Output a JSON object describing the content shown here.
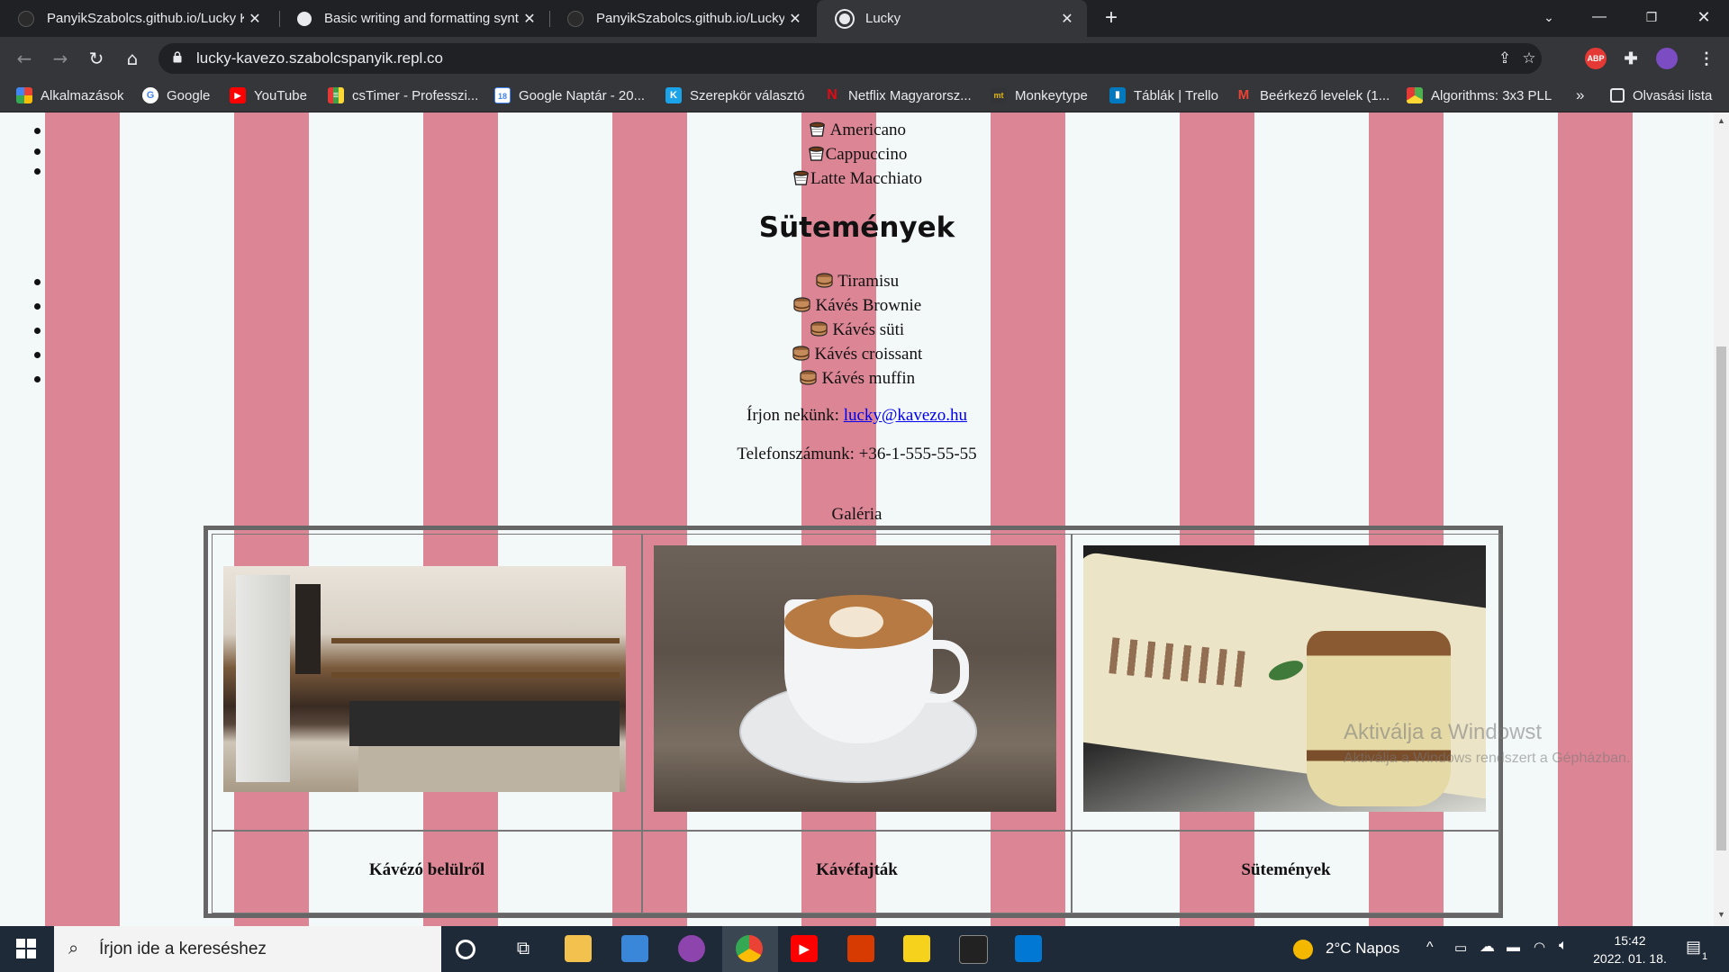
{
  "browser": {
    "tabs": [
      {
        "title": "PanyikSzabolcs.github.io/Lucky K",
        "active": false
      },
      {
        "title": "Basic writing and formatting synt",
        "active": false
      },
      {
        "title": "PanyikSzabolcs.github.io/Lucky K",
        "active": false
      },
      {
        "title": "Lucky",
        "active": true
      }
    ],
    "new_tab": "+",
    "url": "lucky-kavezo.szabolcspanyik.repl.co",
    "ext_abp": "ABP",
    "bookmarks": [
      {
        "label": "Alkalmazások",
        "icon": "apps-grid-icon",
        "color": "#4285f4",
        "glyph": ""
      },
      {
        "label": "Google",
        "icon": "google-icon",
        "color": "#ffffff",
        "glyph": "G"
      },
      {
        "label": "YouTube",
        "icon": "youtube-icon",
        "color": "#ff0000",
        "glyph": "▶"
      },
      {
        "label": "csTimer - Professzi...",
        "icon": "cstimer-icon",
        "color": "#e53935",
        "glyph": "≡"
      },
      {
        "label": "Google Naptár - 20...",
        "icon": "calendar-icon",
        "color": "#4285f4",
        "glyph": "18"
      },
      {
        "label": "Szerepkör választó",
        "icon": "kreta-icon",
        "color": "#1aa3e8",
        "glyph": "K"
      },
      {
        "label": "Netflix Magyarorsz...",
        "icon": "netflix-icon",
        "color": "#202124",
        "glyph": "N"
      },
      {
        "label": "Monkeytype",
        "icon": "monkeytype-icon",
        "color": "#323437",
        "glyph": "mt"
      },
      {
        "label": "Táblák | Trello",
        "icon": "trello-icon",
        "color": "#0079bf",
        "glyph": "▮"
      },
      {
        "label": "Beérkező levelek (1...",
        "icon": "gmail-icon",
        "color": "#202124",
        "glyph": "M"
      },
      {
        "label": "Algorithms: 3x3 PLL",
        "icon": "cube-icon",
        "color": "#4caf50",
        "glyph": "◆"
      }
    ],
    "more": "»",
    "reading_list": "Olvasási lista"
  },
  "page": {
    "coffee_items": [
      "Americano",
      "Cappuccino",
      "Latte Macchiato"
    ],
    "desserts_heading": "Sütemények",
    "dessert_items": [
      "Tiramisu",
      "Kávés Brownie",
      "Kávés süti",
      "Kávés croissant",
      "Kávés muffin"
    ],
    "email_label": "Írjon nekünk: ",
    "email": "lucky@kavezo.hu",
    "phone_label": "Telefonszámunk: +36-1-555-55-55",
    "gallery_caption": "Galéria",
    "gallery": [
      {
        "caption": "Kávézó belülről",
        "image": "cafe-interior"
      },
      {
        "caption": "Kávéfajták",
        "image": "latte-cup"
      },
      {
        "caption": "Sütemények",
        "image": "tiramisu-glass"
      }
    ]
  },
  "watermark": {
    "title": "Aktiválja a Windowst",
    "subtitle": "Aktiválja a Windows rendszert a Gépházban."
  },
  "taskbar": {
    "search_placeholder": "Írjon ide a kereséshez",
    "weather": "2°C  Napos",
    "time": "15:42",
    "date": "2022. 01. 18.",
    "notifications": "1"
  },
  "colors": {
    "stripe_pink": "#dc8595",
    "stripe_white": "#f3f8f9",
    "link": "#0000ee"
  }
}
